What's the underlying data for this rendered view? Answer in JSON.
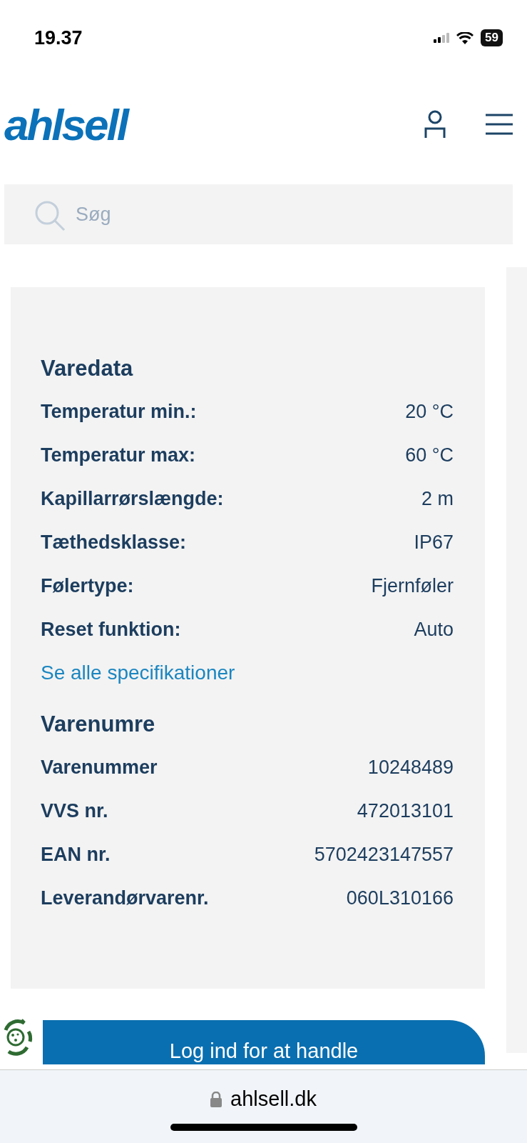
{
  "status_bar": {
    "time": "19.37",
    "battery": "59"
  },
  "header": {
    "logo": "ahlsell"
  },
  "search": {
    "placeholder": "Søg"
  },
  "product_data": {
    "title": "Varedata",
    "rows": [
      {
        "label": "Temperatur min.:",
        "value": "20 °C"
      },
      {
        "label": "Temperatur max:",
        "value": "60 °C"
      },
      {
        "label": "Kapillarrørslængde:",
        "value": "2 m"
      },
      {
        "label": "Tæthedsklasse:",
        "value": "IP67"
      },
      {
        "label": "Følertype:",
        "value": "Fjernføler"
      },
      {
        "label": "Reset funktion:",
        "value": "Auto"
      }
    ],
    "link": "Se alle specifikationer"
  },
  "item_numbers": {
    "title": "Varenumre",
    "rows": [
      {
        "label": "Varenummer",
        "value": "10248489"
      },
      {
        "label": "VVS nr.",
        "value": "472013101"
      },
      {
        "label": "EAN nr.",
        "value": "5702423147557"
      },
      {
        "label": "Leverandørvarenr.",
        "value": "060L310166"
      }
    ]
  },
  "login_button": "Log ind for at handle",
  "browser_bar": {
    "url": "ahlsell.dk"
  }
}
